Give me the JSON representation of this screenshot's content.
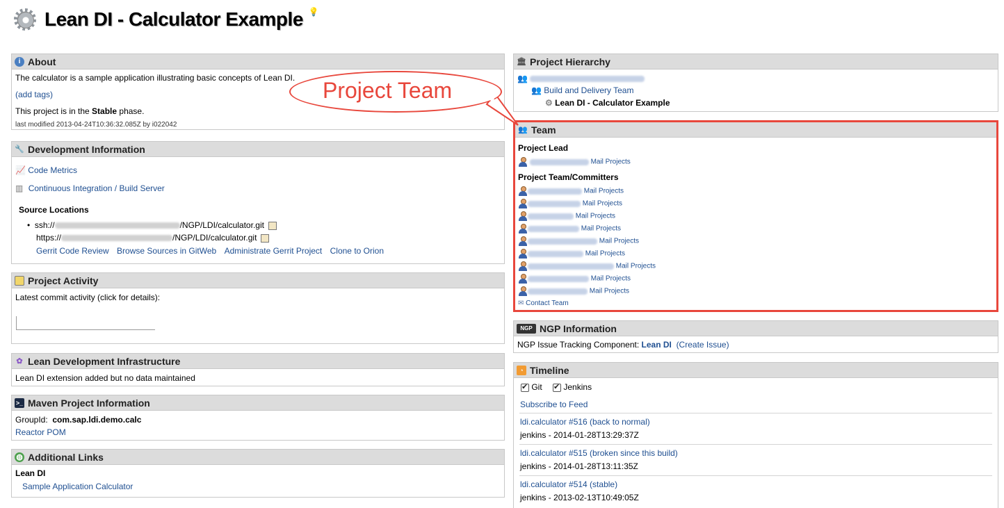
{
  "header": {
    "title": "Lean DI - Calculator Example"
  },
  "about": {
    "title": "About",
    "description": "The calculator is a sample application illustrating basic concepts of Lean DI.",
    "add_tags": "(add tags)",
    "phase_prefix": "This project is in the ",
    "phase": "Stable",
    "phase_suffix": " phase.",
    "last_modified": "last modified 2013-04-24T10:36:32.085Z by i022042"
  },
  "dev": {
    "title": "Development Information",
    "code_metrics": "Code Metrics",
    "ci": "Continuous Integration / Build Server",
    "source_title": "Source Locations",
    "ssh_prefix": "ssh://",
    "ssh_suffix": "/NGP/LDI/calculator.git",
    "https_prefix": "https://",
    "https_suffix": "/NGP/LDI/calculator.git",
    "links": [
      "Gerrit Code Review",
      "Browse Sources in GitWeb",
      "Administrate Gerrit Project",
      "Clone to Orion"
    ]
  },
  "activity": {
    "title": "Project Activity",
    "text": "Latest commit activity (click for details):"
  },
  "lean": {
    "title": "Lean Development Infrastructure",
    "text": "Lean DI extension added but no data maintained"
  },
  "maven": {
    "title": "Maven Project Information",
    "group_label": "GroupId:",
    "group_value": "com.sap.ldi.demo.calc",
    "reactor": "Reactor POM"
  },
  "links": {
    "title": "Additional Links",
    "group": "Lean DI",
    "item": "Sample Application Calculator"
  },
  "hierarchy": {
    "title": "Project Hierarchy",
    "level2": "Build and Delivery Team",
    "current": "Lean DI - Calculator Example"
  },
  "team": {
    "title": "Team",
    "lead_title": "Project Lead",
    "mail": "Mail Projects",
    "committers_title": "Project Team/Committers",
    "contact": "Contact Team"
  },
  "ngp": {
    "title": "NGP Information",
    "label": "NGP Issue Tracking Component:",
    "component": "Lean DI",
    "create": "(Create Issue)"
  },
  "timeline": {
    "title": "Timeline",
    "filters": [
      "Git",
      "Jenkins"
    ],
    "subscribe": "Subscribe to Feed",
    "entries": [
      {
        "link": "ldi.calculator #516 (back to normal)",
        "meta": "jenkins - 2014-01-28T13:29:37Z"
      },
      {
        "link": "ldi.calculator #515 (broken since this build)",
        "meta": "jenkins - 2014-01-28T13:11:35Z"
      },
      {
        "link": "ldi.calculator #514 (stable)",
        "meta": "jenkins - 2013-02-13T10:49:05Z"
      }
    ]
  },
  "callout": {
    "text": "Project Team",
    "color": "#e8473c"
  },
  "colors": {
    "link": "#1f4f91",
    "panel_header": "#dcdcdc",
    "highlight": "#e8473c"
  }
}
